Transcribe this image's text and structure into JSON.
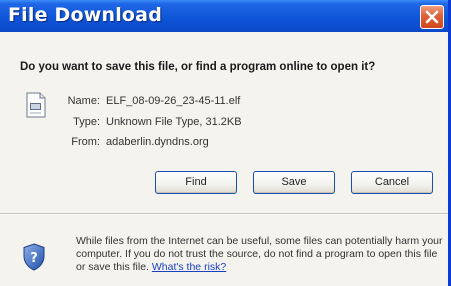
{
  "window": {
    "title": "File Download",
    "close_icon": "close-icon"
  },
  "dialog": {
    "question": "Do you want to save this file, or find a program online to open it?",
    "file_icon": "unknown-file-icon",
    "info": {
      "name_label": "Name:",
      "name_value": "ELF_08-09-26_23-45-11.elf",
      "type_label": "Type:",
      "type_value": "Unknown File Type, 31.2KB",
      "from_label": "From:",
      "from_value": "adaberlin.dyndns.org"
    },
    "buttons": {
      "find": "Find",
      "save": "Save",
      "cancel": "Cancel"
    },
    "warning": {
      "icon": "shield-question-icon",
      "text": "While files from the Internet can be useful, some files can potentially harm your computer. If you do not trust the source, do not find a program to open this file or save this file.",
      "link": "What's the risk?"
    }
  },
  "colors": {
    "titlebar": "#0f55d8",
    "close_button": "#d2461b",
    "link": "#1a3fbf"
  }
}
